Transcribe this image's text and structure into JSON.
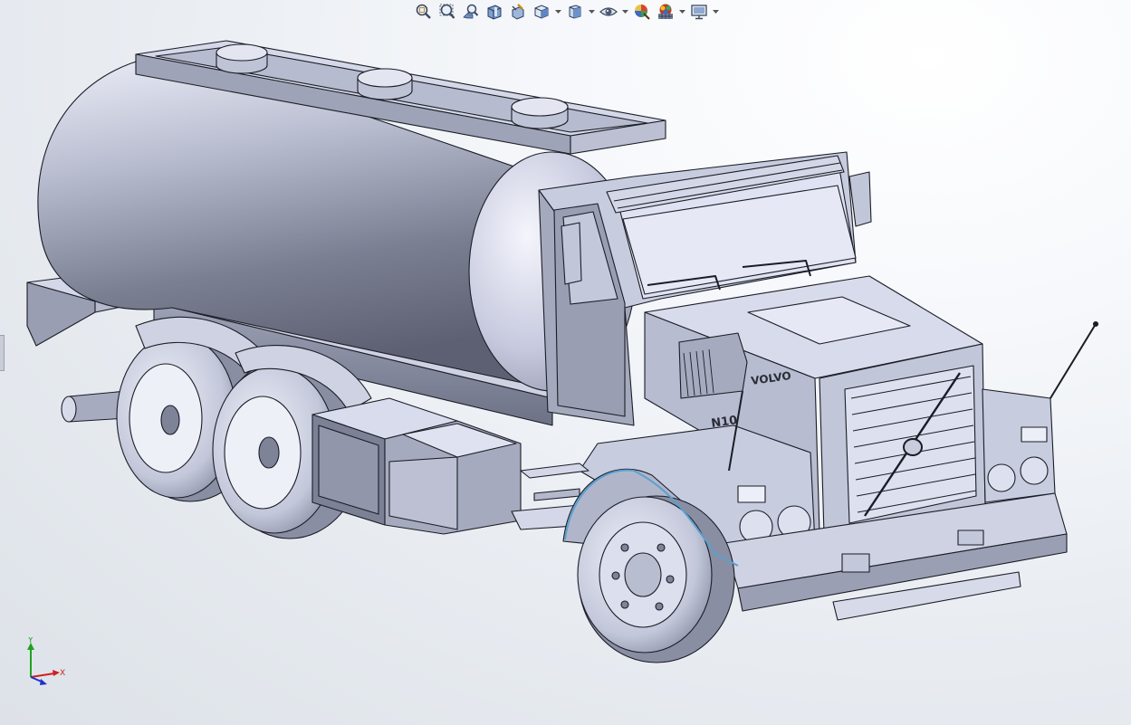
{
  "toolbar": {
    "buttons": [
      {
        "icon": "zoom-to-fit-icon",
        "has_dropdown": false
      },
      {
        "icon": "zoom-to-area-icon",
        "has_dropdown": false
      },
      {
        "icon": "previous-view-icon",
        "has_dropdown": false
      },
      {
        "icon": "section-view-icon",
        "has_dropdown": false
      },
      {
        "icon": "dynamic-annotation-views-icon",
        "has_dropdown": false
      },
      {
        "icon": "view-orientation-icon",
        "has_dropdown": true
      },
      {
        "icon": "display-style-icon",
        "has_dropdown": true
      },
      {
        "icon": "hide-show-items-icon",
        "has_dropdown": true
      },
      {
        "icon": "edit-appearance-icon",
        "has_dropdown": false
      },
      {
        "icon": "apply-scene-icon",
        "has_dropdown": true
      },
      {
        "icon": "view-settings-icon",
        "has_dropdown": true
      }
    ]
  },
  "model": {
    "grille_badge": "VOLVO",
    "side_badge": "N10",
    "body_color": "#c8ccdf",
    "edge_color": "#1b1d26",
    "highlight_color": "#5aa0d0"
  },
  "triad": {
    "x_label": "X",
    "y_label": "Y",
    "z_label": "Z",
    "x_color": "#d02020",
    "y_color": "#20a020",
    "z_color": "#2030d0"
  }
}
